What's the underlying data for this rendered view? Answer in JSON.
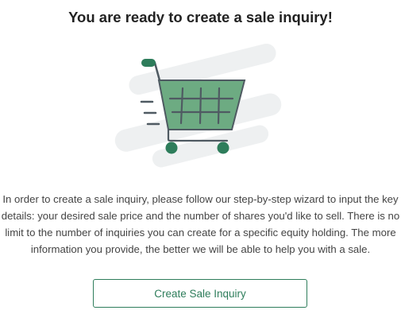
{
  "heading": "You are ready to create a sale inquiry!",
  "illustration": {
    "icon": "shopping-cart-icon",
    "colors": {
      "cart_fill": "#6dab82",
      "cart_outline": "#4f5a62",
      "wheels": "#2e7d5b",
      "handle": "#2e7d5b",
      "background_streaks": "#eef0f1"
    }
  },
  "description": "In order to create a sale inquiry, please follow our step-by-step wizard to input the key details: your desired sale price and the number of shares you'd like to sell. There is no limit to the number of inquiries you can create for a specific equity holding. The more information you provide, the better we will be able to help you with a sale.",
  "cta": {
    "label": "Create Sale Inquiry",
    "accent": "#2e7d5b"
  }
}
